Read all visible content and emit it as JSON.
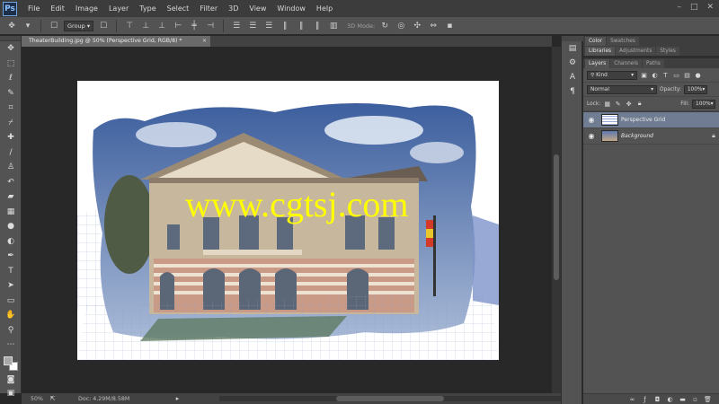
{
  "app": {
    "logo": "Ps"
  },
  "menu": [
    "File",
    "Edit",
    "Image",
    "Layer",
    "Type",
    "Select",
    "Filter",
    "3D",
    "View",
    "Window",
    "Help"
  ],
  "window_controls": [
    "–",
    "□",
    "✕"
  ],
  "options_bar": {
    "auto_select": "Group",
    "mode_label": "3D Mode:"
  },
  "document": {
    "tab_title": "TheaterBuilding.jpg @ 50% (Perspective Grid, RGB/8) *",
    "close": "×"
  },
  "watermark": "www.cgtsj.com",
  "status": {
    "zoom": "50%",
    "doc_info": "Doc: 4.29M/8.58M"
  },
  "panels": {
    "top_tabs": [
      "Color",
      "Swatches"
    ],
    "mid_tabs": [
      "Libraries",
      "Adjustments",
      "Styles"
    ],
    "layer_tabs": [
      "Layers",
      "Channels",
      "Paths"
    ],
    "filter_kind": "Kind",
    "blend_mode": "Normal",
    "opacity_label": "Opacity:",
    "opacity_value": "100%",
    "lock_label": "Lock:",
    "fill_label": "Fill:",
    "fill_value": "100%",
    "layers": [
      {
        "name": "Perspective Grid",
        "selected": true
      },
      {
        "name": "Background",
        "selected": false,
        "locked": true
      }
    ]
  },
  "icons": {
    "tools": [
      "move-icon",
      "marquee-icon",
      "lasso-icon",
      "quick-select-icon",
      "crop-icon",
      "eyedropper-icon",
      "healing-brush-icon",
      "brush-icon",
      "clone-stamp-icon",
      "history-brush-icon",
      "eraser-icon",
      "gradient-icon",
      "blur-icon",
      "dodge-icon",
      "pen-icon",
      "type-icon",
      "path-select-icon",
      "shape-icon",
      "hand-icon",
      "zoom-icon"
    ],
    "colors": {
      "watermark": "#ffff00",
      "selected_layer": "#6f7c91"
    }
  }
}
